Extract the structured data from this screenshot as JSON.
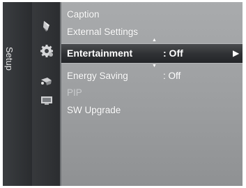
{
  "panel": {
    "tab_label": "Setup"
  },
  "menu": {
    "items": [
      {
        "label": "Caption"
      },
      {
        "label": "External Settings"
      },
      {
        "label": "Entertainment",
        "value": ": Off",
        "selected": true
      },
      {
        "label": "Energy Saving",
        "value": ": Off"
      },
      {
        "label": "PIP",
        "disabled": true
      },
      {
        "label": "SW Upgrade"
      }
    ]
  },
  "icons": [
    "picture-icon",
    "setup-gear-icon",
    "network-icon",
    "input-icon"
  ],
  "colors": {
    "background": "#9c9ea0",
    "sidebar": "#2b2d30",
    "highlight": "#303235",
    "text": "#ffffff",
    "disabled_text": "#c9cbcd"
  }
}
